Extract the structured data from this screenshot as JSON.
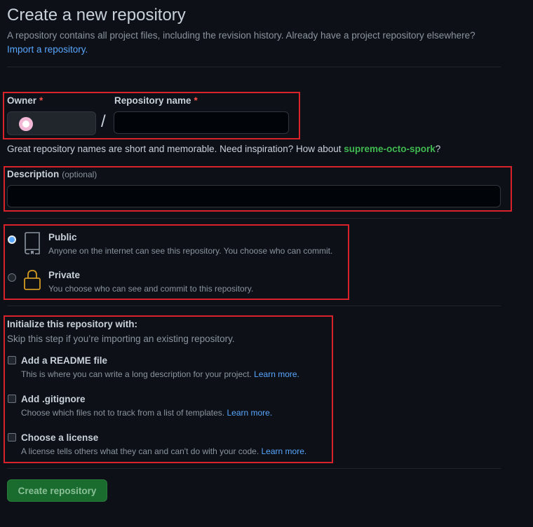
{
  "header": {
    "title": "Create a new repository",
    "subtitle": "A repository contains all project files, including the revision history. Already have a project repository elsewhere?",
    "import_link": "Import a repository."
  },
  "owner": {
    "label": "Owner",
    "required_mark": "*",
    "value": ""
  },
  "separator": "/",
  "repo_name": {
    "label": "Repository name",
    "required_mark": "*",
    "value": ""
  },
  "name_hint": {
    "text": "Great repository names are short and memorable. Need inspiration? How about ",
    "suggestion": "supreme-octo-spork",
    "suffix": "?"
  },
  "description": {
    "label": "Description",
    "optional": "(optional)",
    "value": ""
  },
  "visibility": {
    "selected": "public",
    "public": {
      "title": "Public",
      "desc": "Anyone on the internet can see this repository. You choose who can commit."
    },
    "private": {
      "title": "Private",
      "desc": "You choose who can see and commit to this repository."
    }
  },
  "init": {
    "heading": "Initialize this repository with:",
    "subheading": "Skip this step if you’re importing an existing repository.",
    "readme": {
      "title": "Add a README file",
      "desc": "This is where you can write a long description for your project.",
      "link": "Learn more.",
      "checked": false
    },
    "gitignore": {
      "title": "Add .gitignore",
      "desc": "Choose which files not to track from a list of templates.",
      "link": "Learn more.",
      "checked": false
    },
    "license": {
      "title": "Choose a license",
      "desc": "A license tells others what they can and can't do with your code.",
      "link": "Learn more.",
      "checked": false
    }
  },
  "submit": {
    "label": "Create repository"
  },
  "colors": {
    "background": "#0d1117",
    "annotation_red": "#d9222a",
    "accent_green": "#3fb950",
    "link_blue": "#58a6ff",
    "button_green": "#196c2e"
  }
}
